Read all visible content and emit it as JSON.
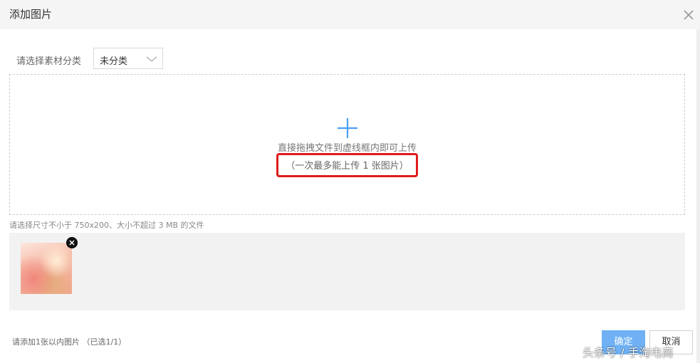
{
  "dialog": {
    "title": "添加图片",
    "close_icon": "close-icon"
  },
  "category": {
    "label": "请选择素材分类",
    "selected": "未分类",
    "chevron_icon": "chevron-down-icon"
  },
  "dropzone": {
    "plus_icon": "plus-icon",
    "drag_text": "直接拖拽文件到虚线框内即可上传",
    "limit_text": "（一次最多能上传 1 张图片）",
    "highlight_color": "#e01b1b"
  },
  "hint": "请选择尺寸不小于 750x200、大小不超过 3 MB 的文件",
  "selected_images": [
    {
      "remove_icon": "close-circle-icon"
    }
  ],
  "footer": {
    "status": "请添加1张以内图片 （已选1/1）",
    "ok_label": "确定",
    "cancel_label": "取消",
    "ok_color": "#6fb1f4"
  },
  "watermark": "头条号 / 手淘电商"
}
